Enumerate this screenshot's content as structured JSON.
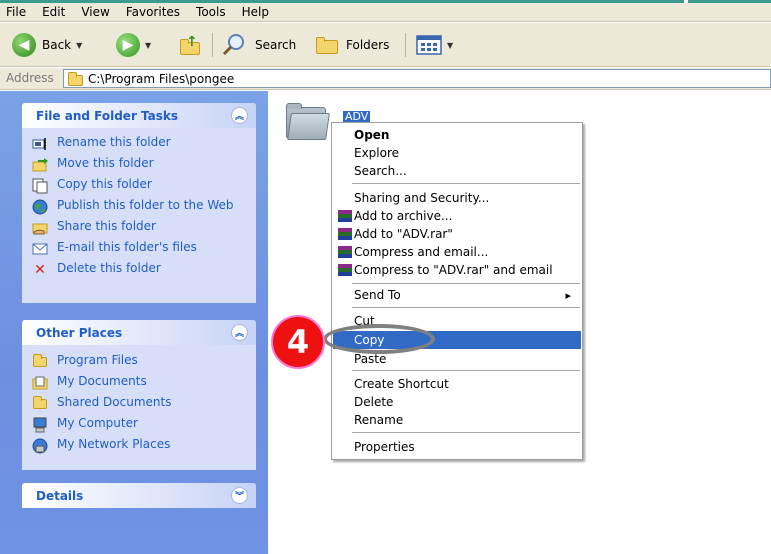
{
  "menubar": {
    "items": [
      "File",
      "Edit",
      "View",
      "Favorites",
      "Tools",
      "Help"
    ]
  },
  "toolbar": {
    "back_label": "Back",
    "search_label": "Search",
    "folders_label": "Folders"
  },
  "address": {
    "label": "Address",
    "path": "C:\\Program Files\\pongee"
  },
  "tasks_panel": {
    "title": "File and Folder Tasks",
    "items": [
      {
        "label": "Rename this folder",
        "icon": "rename-icon"
      },
      {
        "label": "Move this folder",
        "icon": "move-folder-icon"
      },
      {
        "label": "Copy this folder",
        "icon": "copy-folder-icon"
      },
      {
        "label": "Publish this folder to the Web",
        "icon": "globe-icon"
      },
      {
        "label": "Share this folder",
        "icon": "share-hand-icon"
      },
      {
        "label": "E-mail this folder's files",
        "icon": "email-icon"
      },
      {
        "label": "Delete this folder",
        "icon": "delete-x-icon"
      }
    ]
  },
  "places_panel": {
    "title": "Other Places",
    "items": [
      {
        "label": "Program Files",
        "icon": "folder-icon"
      },
      {
        "label": "My Documents",
        "icon": "my-documents-icon"
      },
      {
        "label": "Shared Documents",
        "icon": "folder-icon"
      },
      {
        "label": "My Computer",
        "icon": "computer-icon"
      },
      {
        "label": "My Network Places",
        "icon": "network-places-icon"
      }
    ]
  },
  "details_panel": {
    "title": "Details"
  },
  "folder": {
    "name": "ADV"
  },
  "context_menu": {
    "open": "Open",
    "explore": "Explore",
    "search": "Search...",
    "sharing": "Sharing and Security...",
    "add_archive": "Add to archive...",
    "add_rar": "Add to \"ADV.rar\"",
    "compress_email": "Compress and email...",
    "compress_rar_email": "Compress to \"ADV.rar\" and email",
    "send_to": "Send To",
    "cut": "Cut",
    "copy": "Copy",
    "paste": "Paste",
    "create_shortcut": "Create Shortcut",
    "delete": "Delete",
    "rename": "Rename",
    "properties": "Properties"
  },
  "annotation": {
    "step_number": "4"
  },
  "colors": {
    "selection": "#316ac5",
    "task_link": "#215dc6",
    "step_badge": "#ee1111"
  }
}
